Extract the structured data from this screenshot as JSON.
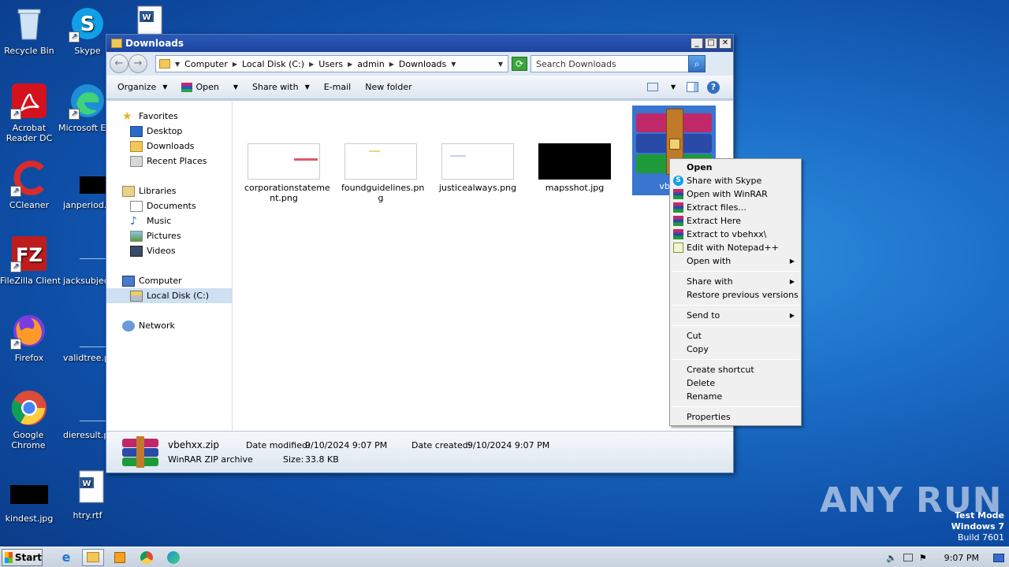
{
  "desktop": {
    "icons": [
      {
        "label": "Recycle Bin"
      },
      {
        "label": "Skype"
      },
      {
        "label": "Acrobat Reader DC"
      },
      {
        "label": "Microsoft Edge"
      },
      {
        "label": "CCleaner"
      },
      {
        "label": "janperiod.jpg"
      },
      {
        "label": "FileZilla Client"
      },
      {
        "label": "jacksubject"
      },
      {
        "label": "Firefox"
      },
      {
        "label": "validtree.png"
      },
      {
        "label": "Google Chrome"
      },
      {
        "label": "dieresult.png"
      },
      {
        "label": "kindest.jpg"
      },
      {
        "label": "htry.rtf"
      }
    ]
  },
  "window": {
    "title": "Downloads",
    "breadcrumb": [
      "Computer",
      "Local Disk (C:)",
      "Users",
      "admin",
      "Downloads"
    ],
    "search_placeholder": "Search Downloads",
    "toolbar": {
      "organize": "Organize",
      "open": "Open",
      "share_with": "Share with",
      "email": "E-mail",
      "new_folder": "New folder"
    },
    "nav": {
      "favorites": "Favorites",
      "desktop": "Desktop",
      "downloads": "Downloads",
      "recent": "Recent Places",
      "libraries": "Libraries",
      "documents": "Documents",
      "music": "Music",
      "pictures": "Pictures",
      "videos": "Videos",
      "computer": "Computer",
      "local_disk": "Local Disk (C:)",
      "network": "Network"
    },
    "files": [
      {
        "name": "corporationstatement.png",
        "name_l1": "corporationstateme",
        "name_l2": "nt.png"
      },
      {
        "name": "foundguidelines.png",
        "name_l1": "foundguidelines.pn",
        "name_l2": "g"
      },
      {
        "name": "justicealways.png",
        "name_l1": "justicealways.png",
        "name_l2": ""
      },
      {
        "name": "mapsshot.jpg",
        "name_l1": "mapsshot.jpg",
        "name_l2": ""
      },
      {
        "name": "vbehxx.zip",
        "name_l1": "vbeh",
        "name_l2": ""
      }
    ],
    "status": {
      "filename": "vbehxx.zip",
      "type": "WinRAR ZIP archive",
      "modified_label": "Date modified:",
      "modified_value": "9/10/2024 9:07 PM",
      "created_label": "Date created:",
      "created_value": "9/10/2024 9:07 PM",
      "size_label": "Size:",
      "size_value": "33.8 KB"
    }
  },
  "context_menu": {
    "open": "Open",
    "share_skype": "Share with Skype",
    "open_winrar": "Open with WinRAR",
    "extract_files": "Extract files...",
    "extract_here": "Extract Here",
    "extract_to": "Extract to vbehxx\\",
    "edit_npp": "Edit with Notepad++",
    "open_with": "Open with",
    "share_with": "Share with",
    "restore": "Restore previous versions",
    "send_to": "Send to",
    "cut": "Cut",
    "copy": "Copy",
    "create_shortcut": "Create shortcut",
    "delete": "Delete",
    "rename": "Rename",
    "properties": "Properties"
  },
  "taskbar": {
    "start": "Start",
    "clock": "9:07 PM"
  },
  "overlay": {
    "watermark": "ANY RUN",
    "test_mode_l1": "Test Mode",
    "test_mode_l2": "Windows 7",
    "test_mode_l3": "Build 7601"
  },
  "colors": {
    "selection": "#3876d0",
    "titlebar": "#1d44a0"
  }
}
